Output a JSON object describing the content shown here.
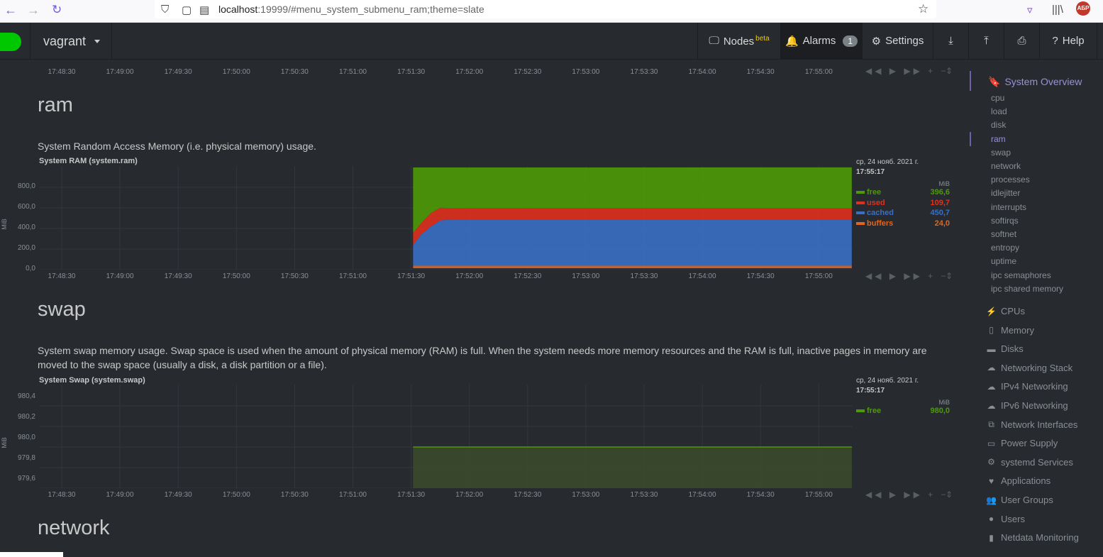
{
  "browser": {
    "url_host": "localhost",
    "url_path": ":19999/#menu_system_submenu_ram;theme=slate",
    "badge": "АБР"
  },
  "header": {
    "hostname": "vagrant",
    "nodes_label": "Nodes",
    "nodes_sup": "beta",
    "alarms_label": "Alarms",
    "alarms_count": "1",
    "settings_label": "Settings",
    "help_label": "Help"
  },
  "time_ticks": [
    "17:48:30",
    "17:49:00",
    "17:49:30",
    "17:50:00",
    "17:50:30",
    "17:51:00",
    "17:51:30",
    "17:52:00",
    "17:52:30",
    "17:53:00",
    "17:53:30",
    "17:54:00",
    "17:54:30",
    "17:55:00"
  ],
  "sections": {
    "ram": {
      "title": "ram",
      "desc": "System Random Access Memory (i.e. physical memory) usage.",
      "chart_title": "System RAM (system.ram)",
      "ylabel": "MiB",
      "yticks": [
        "800,0",
        "600,0",
        "400,0",
        "200,0",
        "0,0"
      ],
      "legend_date": "ср, 24 нояб. 2021 г.",
      "legend_time": "17:55:17",
      "legend_unit": "MiB",
      "dims": [
        {
          "name": "free",
          "value": "396,6",
          "color": "#4e9a06"
        },
        {
          "name": "used",
          "value": "109,7",
          "color": "#e0301e"
        },
        {
          "name": "cached",
          "value": "450,7",
          "color": "#3a6fc4"
        },
        {
          "name": "buffers",
          "value": "24,0",
          "color": "#e0651e"
        }
      ]
    },
    "swap": {
      "title": "swap",
      "desc": "System swap memory usage. Swap space is used when the amount of physical memory (RAM) is full. When the system needs more memory resources and the RAM is full, inactive pages in memory are moved to the swap space (usually a disk, a disk partition or a file).",
      "chart_title": "System Swap (system.swap)",
      "ylabel": "MiB",
      "yticks": [
        "980,4",
        "980,2",
        "980,0",
        "979,8",
        "979,6"
      ],
      "legend_date": "ср, 24 нояб. 2021 г.",
      "legend_time": "17:55:17",
      "legend_unit": "MiB",
      "dims": [
        {
          "name": "free",
          "value": "980,0",
          "color": "#4e9a06"
        }
      ]
    },
    "network": {
      "title": "network"
    }
  },
  "sidebar": {
    "head": "System Overview",
    "subs": [
      "cpu",
      "load",
      "disk",
      "ram",
      "swap",
      "network",
      "processes",
      "idlejitter",
      "interrupts",
      "softirqs",
      "softnet",
      "entropy",
      "uptime",
      "ipc semaphores",
      "ipc shared memory"
    ],
    "active_sub": "ram",
    "cats": [
      {
        "label": "CPUs",
        "icon": "bolt-icon",
        "glyph": "⚡"
      },
      {
        "label": "Memory",
        "icon": "memory-icon",
        "glyph": "▯"
      },
      {
        "label": "Disks",
        "icon": "hdd-icon",
        "glyph": "▬"
      },
      {
        "label": "Networking Stack",
        "icon": "cloud-icon",
        "glyph": "☁"
      },
      {
        "label": "IPv4 Networking",
        "icon": "cloud-icon",
        "glyph": "☁"
      },
      {
        "label": "IPv6 Networking",
        "icon": "cloud-icon",
        "glyph": "☁"
      },
      {
        "label": "Network Interfaces",
        "icon": "sitemap-icon",
        "glyph": "⧉"
      },
      {
        "label": "Power Supply",
        "icon": "battery-icon",
        "glyph": "▭"
      },
      {
        "label": "systemd Services",
        "icon": "cogs-icon",
        "glyph": "⚙"
      },
      {
        "label": "Applications",
        "icon": "heartbeat-icon",
        "glyph": "♥"
      },
      {
        "label": "User Groups",
        "icon": "users-icon",
        "glyph": "👥"
      },
      {
        "label": "Users",
        "icon": "user-icon",
        "glyph": "●"
      },
      {
        "label": "Netdata Monitoring",
        "icon": "chart-bar-icon",
        "glyph": "▮"
      }
    ]
  },
  "chart_data": [
    {
      "type": "area",
      "title": "System RAM (system.ram)",
      "ylabel": "MiB",
      "x": [
        "17:51:31",
        "17:51:35",
        "17:51:40",
        "17:51:45",
        "17:51:50",
        "17:52:00",
        "17:55:17"
      ],
      "ylim": [
        0,
        980
      ],
      "stacked": true,
      "series": [
        {
          "name": "buffers",
          "values": [
            24,
            24,
            24,
            24,
            24,
            24,
            24
          ]
        },
        {
          "name": "cached",
          "values": [
            200,
            300,
            380,
            440,
            450,
            451,
            450.7
          ]
        },
        {
          "name": "used",
          "values": [
            120,
            110,
            130,
            125,
            110,
            110,
            109.7
          ]
        },
        {
          "name": "free",
          "values": [
            636,
            546,
            446,
            391,
            396,
            395,
            396.6
          ]
        }
      ]
    },
    {
      "type": "area",
      "title": "System Swap (system.swap)",
      "ylabel": "MiB",
      "x": [
        "17:51:31",
        "17:55:17"
      ],
      "ylim": [
        979.5,
        980.5
      ],
      "series": [
        {
          "name": "free",
          "values": [
            980.0,
            980.0
          ]
        }
      ]
    }
  ]
}
